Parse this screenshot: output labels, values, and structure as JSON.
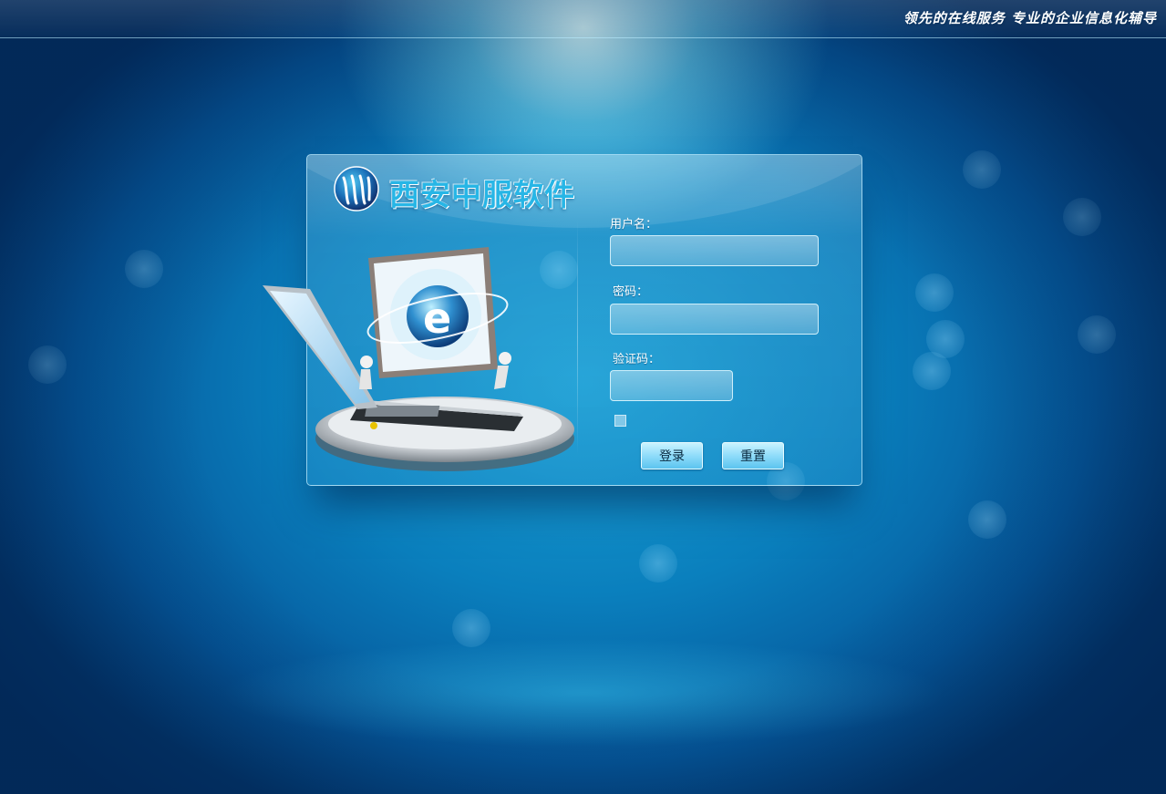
{
  "header": {
    "slogan": "领先的在线服务 专业的企业信息化辅导"
  },
  "brand": {
    "name": "西安中服软件",
    "logo_icon": "wave-w-logo-icon"
  },
  "illustration": {
    "icon": "laptop-internet-explorer-illustration"
  },
  "login_form": {
    "username_label": "用户名：",
    "username_value": "",
    "password_label": "密码：",
    "password_value": "",
    "captcha_label": "验证码：",
    "captcha_value": "",
    "remember_checked": false,
    "login_button": "登录",
    "reset_button": "重置"
  },
  "colors": {
    "brand_text": "#27b6e6",
    "button_gradient_top": "#c9f3ff",
    "button_gradient_bottom": "#5cc4ef",
    "background": "#0566a8"
  }
}
